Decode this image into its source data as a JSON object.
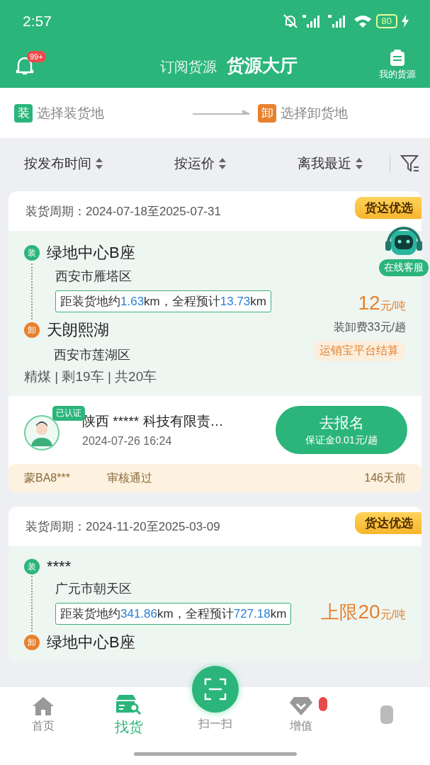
{
  "status_bar": {
    "time": "2:57",
    "battery": "80"
  },
  "header": {
    "badge": "99+",
    "tabs": [
      {
        "label": "订阅货源",
        "selected": false
      },
      {
        "label": "货源大厅",
        "selected": true
      }
    ],
    "my_cargo": "我的货源"
  },
  "route_picker": {
    "load": {
      "tag": "装",
      "placeholder": "选择装货地"
    },
    "unload": {
      "tag": "卸",
      "placeholder": "选择卸货地"
    }
  },
  "sort_options": [
    {
      "label": "按发布时间"
    },
    {
      "label": "按运价"
    },
    {
      "label": "离我最近"
    }
  ],
  "cards": [
    {
      "period": "装货周期：2024-07-18至2025-07-31",
      "badge": "货达优选",
      "load": {
        "tag": "装",
        "name": "绿地中心B座",
        "district": "西安市雁塔区"
      },
      "distance": [
        {
          "kind": "text",
          "text": "距装货地约"
        },
        {
          "kind": "number",
          "text": "1.63"
        },
        {
          "kind": "text",
          "text": "km，全程预计"
        },
        {
          "kind": "number",
          "text": "13.73"
        },
        {
          "kind": "text",
          "text": "km"
        }
      ],
      "unload": {
        "tag": "卸",
        "name": "天朗熙湖",
        "district": "西安市莲湖区"
      },
      "cargo": "精煤 | 剩19车 | 共20车",
      "price": {
        "amount": "12",
        "unit": "元/吨"
      },
      "fee": "装卸费33元/趟",
      "settlement": "运销宝平台结算",
      "shipper": {
        "verified": "已认证",
        "company": "陕西 ***** 科技有限责…",
        "time": "2024-07-26 16:24"
      },
      "apply": {
        "label": "去报名",
        "deposit": "保证金0.01元/趟"
      },
      "strip": {
        "plate": "蒙BA8***",
        "status": "审核通过",
        "age": "146天前"
      }
    },
    {
      "period": "装货周期：2024-11-20至2025-03-09",
      "badge": "货达优选",
      "load": {
        "tag": "装",
        "name": "****",
        "district": "广元市朝天区"
      },
      "distance": [
        {
          "kind": "text",
          "text": "距装货地约"
        },
        {
          "kind": "number",
          "text": "341.86"
        },
        {
          "kind": "text",
          "text": "km，全程预计"
        },
        {
          "kind": "number",
          "text": "727.18"
        },
        {
          "kind": "text",
          "text": "km"
        }
      ],
      "unload": {
        "tag": "卸",
        "name": "绿地中心B座"
      },
      "price": {
        "prefix": "上限",
        "amount": "20",
        "unit": "元/吨"
      }
    }
  ],
  "chat_widget": {
    "label": "在线客服"
  },
  "bottom_nav": [
    {
      "kind": "tab",
      "label": "首页",
      "selected": false,
      "dot": false
    },
    {
      "kind": "tab",
      "label": "找货",
      "selected": true,
      "dot": false
    },
    {
      "kind": "scan",
      "label": "扫一扫",
      "selected": false,
      "dot": false
    },
    {
      "kind": "tab",
      "label": "增值",
      "selected": false,
      "dot": true
    },
    {
      "kind": "tab",
      "selected": false,
      "dot": false
    }
  ]
}
